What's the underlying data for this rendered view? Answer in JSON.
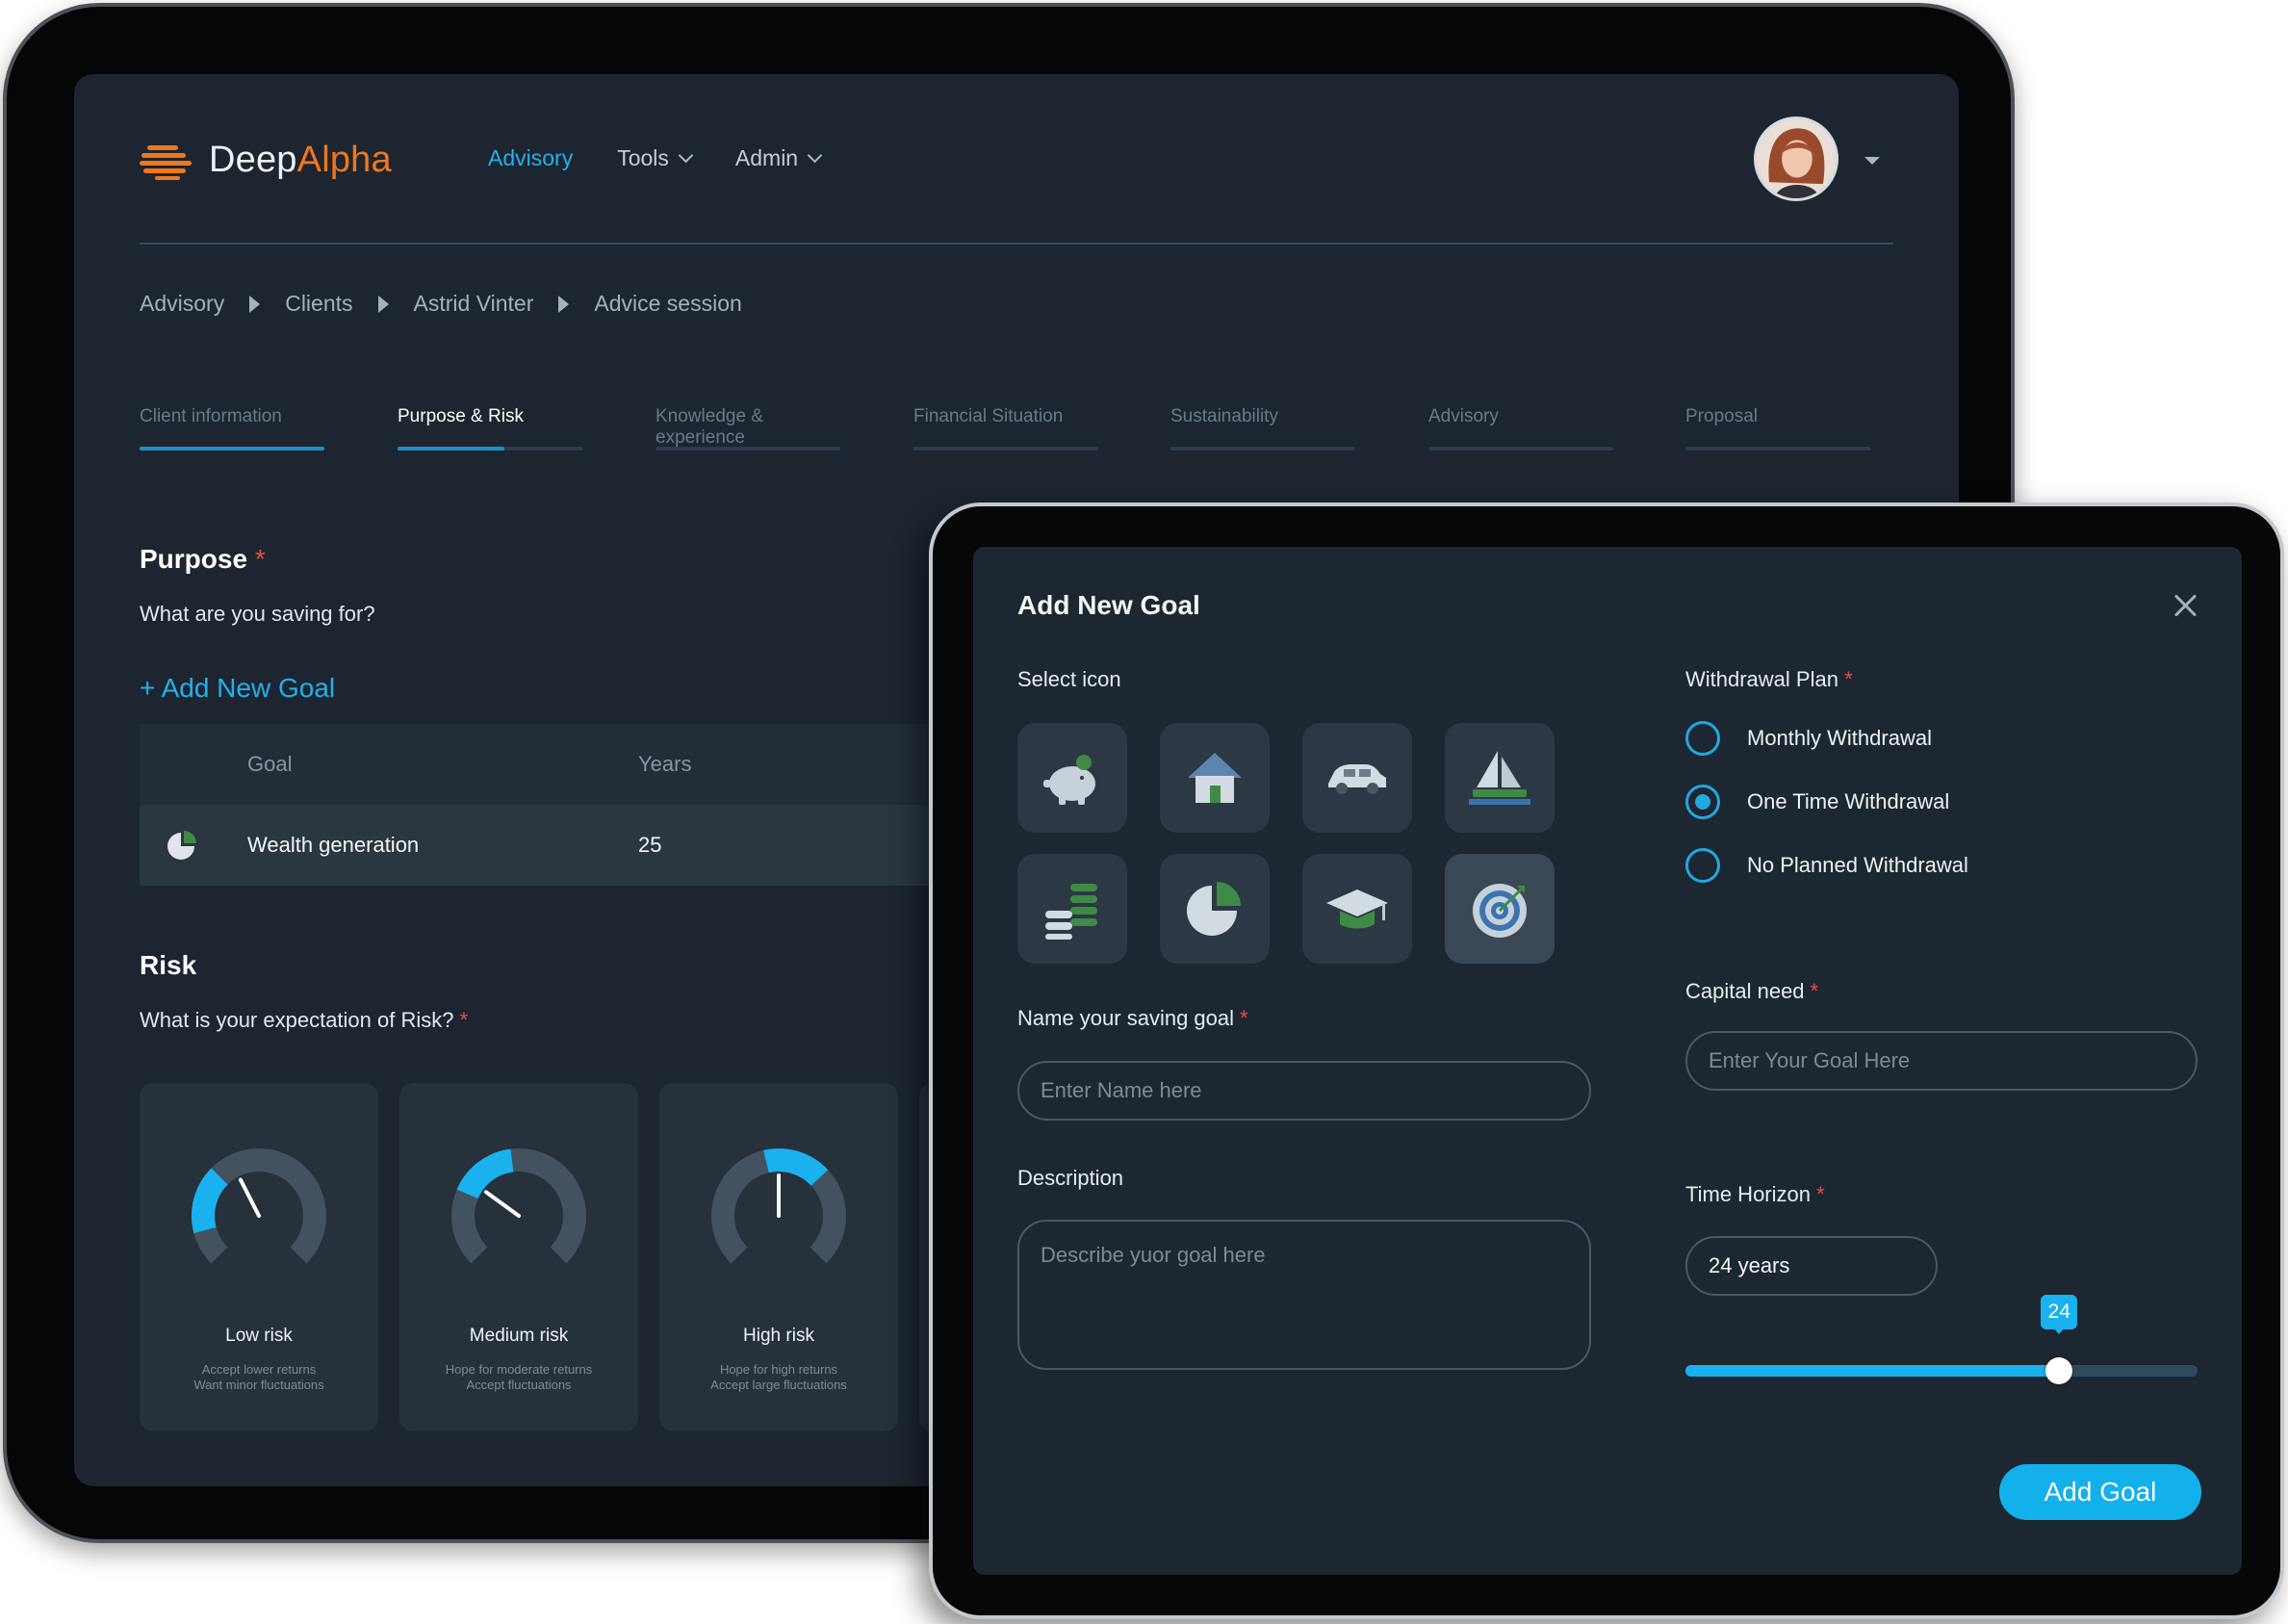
{
  "app": {
    "logo_part1": "Deep",
    "logo_part2": "Alpha",
    "nav": [
      {
        "label": "Advisory"
      },
      {
        "label": "Tools"
      },
      {
        "label": "Admin"
      }
    ],
    "accent_color": "#22b1ea",
    "brand_color": "#f0771e"
  },
  "breadcrumb": [
    "Advisory",
    "Clients",
    "Astrid Vinter",
    "Advice session"
  ],
  "tabs": [
    {
      "label": "Client information",
      "progress": 1.0
    },
    {
      "label": "Purpose & Risk",
      "progress": 0.58
    },
    {
      "label": "Knowledge & experience",
      "progress": 0
    },
    {
      "label": "Financial Situation",
      "progress": 0
    },
    {
      "label": "Sustainability",
      "progress": 0
    },
    {
      "label": "Advisory",
      "progress": 0
    },
    {
      "label": "Proposal",
      "progress": 0
    }
  ],
  "purpose": {
    "title": "Purpose",
    "required_mark": "*",
    "question": "What are you saving for?",
    "add_link": "+ Add New Goal",
    "table": {
      "headers": [
        "Goal",
        "Years"
      ],
      "rows": [
        {
          "icon": "pie-chart-icon",
          "goal": "Wealth generation",
          "years": "25"
        }
      ]
    }
  },
  "risk": {
    "title": "Risk",
    "question": "What is your expectation of Risk?",
    "required_mark": "*",
    "cards": [
      {
        "label": "Low risk",
        "desc1": "Accept lower returns",
        "desc2": "Want minor fluctuations",
        "level": 0.2
      },
      {
        "label": "Medium risk",
        "desc1": "Hope for moderate returns",
        "desc2": "Accept fluctuations",
        "level": 0.4
      },
      {
        "label": "High risk",
        "desc1": "Hope for high returns",
        "desc2": "Accept large fluctuations",
        "level": 0.6
      }
    ]
  },
  "modal": {
    "title": "Add New Goal",
    "select_icon_label": "Select icon",
    "icons": [
      {
        "name": "piggy-bank-icon",
        "selected": false
      },
      {
        "name": "house-icon",
        "selected": false
      },
      {
        "name": "car-icon",
        "selected": false
      },
      {
        "name": "sailboat-icon",
        "selected": false
      },
      {
        "name": "coins-icon",
        "selected": false
      },
      {
        "name": "pie-chart-icon",
        "selected": false
      },
      {
        "name": "graduation-cap-icon",
        "selected": false
      },
      {
        "name": "target-icon",
        "selected": true
      }
    ],
    "name_label": "Name your saving goal",
    "name_placeholder": "Enter Name here",
    "description_label": "Description",
    "description_placeholder": "Describe yuor goal here",
    "withdrawal_label": "Withdrawal Plan",
    "withdrawal_options": [
      {
        "label": "Monthly Withdrawal",
        "selected": false
      },
      {
        "label": "One Time Withdrawal",
        "selected": true
      },
      {
        "label": "No Planned Withdrawal",
        "selected": false
      }
    ],
    "capital_label": "Capital need",
    "capital_placeholder": "Enter Your Goal Here",
    "horizon_label": "Time Horizon",
    "horizon_value": "24 years",
    "slider": {
      "value": 24,
      "bubble": "24",
      "fill_fraction": 0.73
    },
    "required_mark": "*",
    "submit_label": "Add Goal"
  }
}
